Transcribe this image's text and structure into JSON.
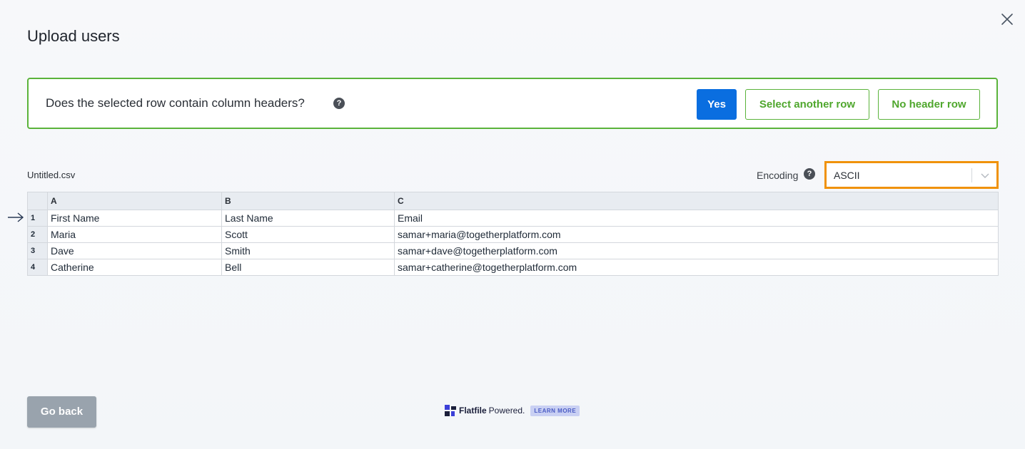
{
  "dialog": {
    "title": "Upload users",
    "close_icon": "close-icon"
  },
  "header_prompt": {
    "question": "Does the selected row contain column headers?",
    "help_icon": "?",
    "yes_label": "Yes",
    "select_another_label": "Select another row",
    "no_header_label": "No header row"
  },
  "file": {
    "name": "Untitled.csv",
    "encoding_label": "Encoding",
    "encoding_help": "?",
    "encoding_value": "ASCII"
  },
  "grid": {
    "columns": [
      "A",
      "B",
      "C"
    ],
    "selected_row": "1",
    "rows": [
      {
        "num": "1",
        "cells": [
          "First Name",
          "Last Name",
          "Email"
        ]
      },
      {
        "num": "2",
        "cells": [
          "Maria",
          "Scott",
          "samar+maria@togetherplatform.com"
        ]
      },
      {
        "num": "3",
        "cells": [
          "Dave",
          "Smith",
          "samar+dave@togetherplatform.com"
        ]
      },
      {
        "num": "4",
        "cells": [
          "Catherine",
          "Bell",
          "samar+catherine@togetherplatform.com"
        ]
      }
    ]
  },
  "footer": {
    "go_back_label": "Go back",
    "brand": "Flatfile",
    "powered": "Powered.",
    "learn_more": "LEARN MORE"
  },
  "colors": {
    "primary": "#0a6ee0",
    "success_border": "#5ab33a",
    "highlight": "#f0920a",
    "disabled_button": "#99a3ad"
  }
}
